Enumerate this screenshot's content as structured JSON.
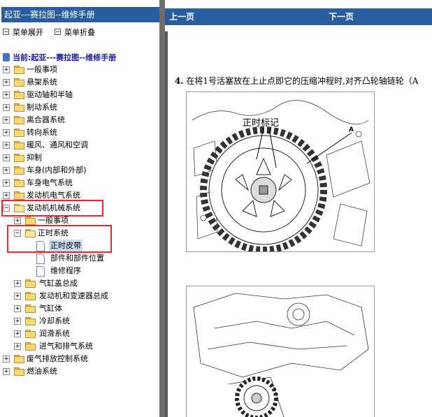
{
  "sidebar": {
    "title": "起亚---赛拉图--维修手册",
    "expand_label": "菜单展开",
    "collapse_label": "菜单折叠",
    "root_label": "当前:起亚---赛拉图--维修手册",
    "items": [
      {
        "label": "一般事项"
      },
      {
        "label": "悬架系统"
      },
      {
        "label": "驱动轴和半轴"
      },
      {
        "label": "制动系统"
      },
      {
        "label": "离合器系统"
      },
      {
        "label": "转向系统"
      },
      {
        "label": "暖风、通风和空调"
      },
      {
        "label": "抑制"
      },
      {
        "label": "车身(内部和外部)"
      },
      {
        "label": "车身电气系统"
      },
      {
        "label": "发动机电气系统"
      },
      {
        "label": "发动机机械系统"
      },
      {
        "label": "一般事项"
      },
      {
        "label": "正时系统"
      },
      {
        "label": "正时皮带"
      },
      {
        "label": "部件和部件位置"
      },
      {
        "label": "维修程序"
      },
      {
        "label": "气缸盖总成"
      },
      {
        "label": "发动机和变速器总成"
      },
      {
        "label": "气缸体"
      },
      {
        "label": "冷却系统"
      },
      {
        "label": "润滑系统"
      },
      {
        "label": "进气和排气系统"
      },
      {
        "label": "废气排放控制系统"
      },
      {
        "label": "燃油系统"
      }
    ]
  },
  "content": {
    "prev_label": "上一页",
    "next_label": "下一页",
    "step_number": "4.",
    "step_text": "在将1号活塞放在上止点即它的压缩冲程时,对齐凸轮轴链轮（A",
    "figure1": {
      "label_timing_mark": "正时标记",
      "label_a": "A"
    }
  },
  "colors": {
    "title_bar": "#2a5d9f",
    "highlight_box": "#e4282e",
    "selected_bg": "#c9dcf2"
  }
}
